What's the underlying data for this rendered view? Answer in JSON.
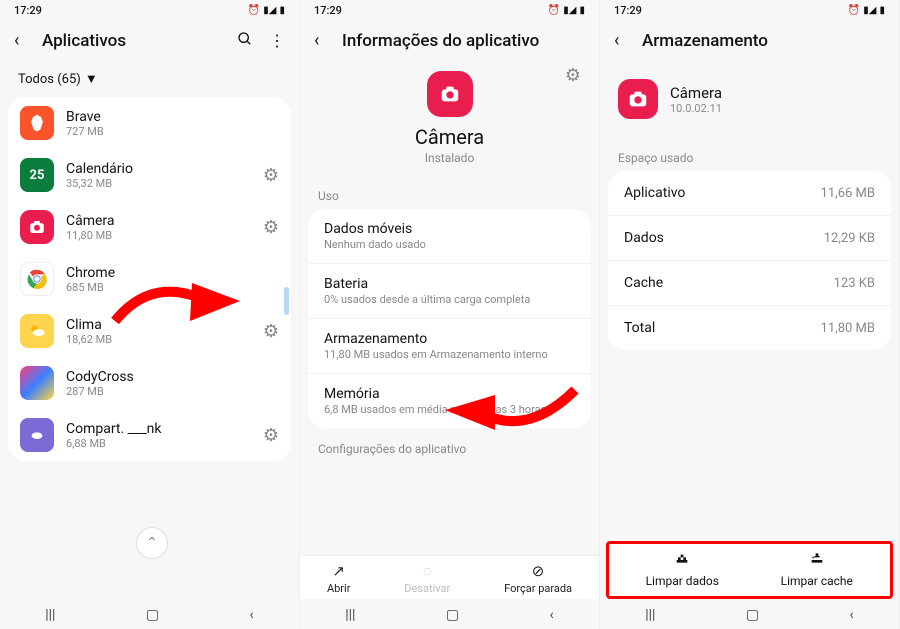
{
  "status": {
    "time": "17:29"
  },
  "panel1": {
    "title": "Aplicativos",
    "filter": "Todos (65)",
    "apps": [
      {
        "name": "Brave",
        "size": "727 MB"
      },
      {
        "name": "Calendário",
        "size": "35,32 MB"
      },
      {
        "name": "Câmera",
        "size": "11,80 MB"
      },
      {
        "name": "Chrome",
        "size": "685 MB"
      },
      {
        "name": "Clima",
        "size": "18,62 MB"
      },
      {
        "name": "CodyCross",
        "size": "287 MB"
      },
      {
        "name": "Compart. ___nk",
        "size": "6,88 MB"
      }
    ]
  },
  "panel2": {
    "title": "Informações do aplicativo",
    "appName": "Câmera",
    "status": "Instalado",
    "sectionUso": "Uso",
    "rows": {
      "dados": {
        "title": "Dados móveis",
        "sub": "Nenhum dado usado"
      },
      "bateria": {
        "title": "Bateria",
        "sub": "0% usados desde a última carga completa"
      },
      "armazenamento": {
        "title": "Armazenamento",
        "sub": "11,80 MB usados em Armazenamento interno"
      },
      "memoria": {
        "title": "Memória",
        "sub": "6,8 MB usados em média nas últimas 3 horas"
      }
    },
    "sectionConfig": "Configurações do aplicativo",
    "actions": {
      "abrir": "Abrir",
      "desativar": "Desativar",
      "forcar": "Forçar parada"
    }
  },
  "panel3": {
    "title": "Armazenamento",
    "appName": "Câmera",
    "version": "10.0.02.11",
    "section": "Espaço usado",
    "rows": {
      "aplicativo": {
        "label": "Aplicativo",
        "value": "11,66 MB"
      },
      "dados": {
        "label": "Dados",
        "value": "12,29 KB"
      },
      "cache": {
        "label": "Cache",
        "value": "123 KB"
      },
      "total": {
        "label": "Total",
        "value": "11,80 MB"
      }
    },
    "actions": {
      "limparDados": "Limpar dados",
      "limparCache": "Limpar cache"
    }
  }
}
